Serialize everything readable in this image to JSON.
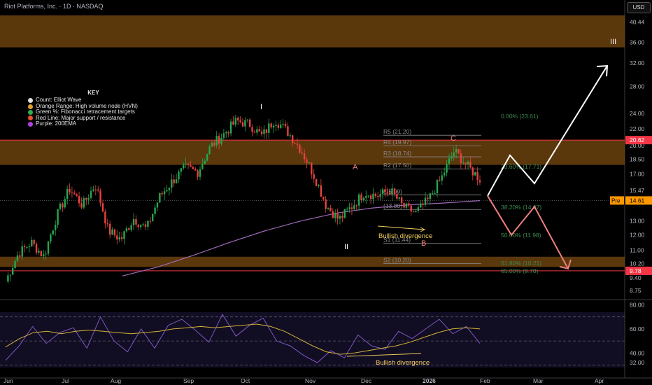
{
  "header": {
    "symbol_line": "Riot Platforms, Inc. · 1D · NASDAQ",
    "currency": "USD"
  },
  "key": {
    "title": "KEY",
    "items": [
      {
        "label": "Count: Elliot Wave",
        "color": "#e0e0e0"
      },
      {
        "label": "Orange Range: High volume node (HVN)",
        "color": "#e0a030"
      },
      {
        "label": "Green %: Fibonacci retracement targets",
        "color": "#2eae4f"
      },
      {
        "label": "Red Line: Major support / resistance",
        "color": "#e8502a"
      },
      {
        "label": "Purple: 200EMA",
        "color": "#b040e0"
      }
    ]
  },
  "price_axis": {
    "ticks": [
      "40.44",
      "36.00",
      "32.00",
      "28.00",
      "24.00",
      "22.00",
      "20.00",
      "18.50",
      "17.00",
      "15.47",
      "13.00",
      "12.00",
      "11.00",
      "10.20",
      "9.40",
      "8.75"
    ],
    "highlight_labels": [
      {
        "text": "20.62",
        "value": 20.62,
        "color": "#f23645"
      },
      {
        "text": "9.78",
        "value": 9.78,
        "color": "#f23645"
      }
    ],
    "pre_label": {
      "tag": "Pre",
      "text": "14.61",
      "value": 14.61,
      "color": "#ff9800"
    }
  },
  "rsi_axis": {
    "ticks": [
      "80.00",
      "60.00",
      "40.00",
      "32.00"
    ]
  },
  "time_axis": {
    "labels": [
      "Jun",
      "Jul",
      "Aug",
      "Sep",
      "Oct",
      "Nov",
      "Dec",
      "2026",
      "Feb",
      "Mar",
      "Apr"
    ]
  },
  "chart_data": {
    "type": "candlestick",
    "title": "Riot Platforms, Inc. · 1D · NASDAQ",
    "y_scale": "log",
    "ylim": [
      8.4,
      42
    ],
    "hvn_zones": [
      [
        35.0,
        42.0
      ],
      [
        17.9,
        20.62
      ],
      [
        10.0,
        10.6
      ]
    ],
    "support_resistance_lines": [
      20.62,
      9.78
    ],
    "pivot_levels": [
      {
        "label": "R5 (21.20)",
        "value": 21.2
      },
      {
        "label": "R4 (19.97)",
        "value": 19.97
      },
      {
        "label": "R3 (18.74)",
        "value": 18.74
      },
      {
        "label": "R2 (17.50)",
        "value": 17.5
      },
      {
        "label": "(15.09)",
        "value": 15.09
      },
      {
        "label": "(13.88)",
        "value": 13.88
      },
      {
        "label": "S1 (11.44)",
        "value": 11.44
      },
      {
        "label": "S2 (10.20)",
        "value": 10.2
      }
    ],
    "fib_levels": [
      {
        "label": "0.00% (23.61)",
        "value": 23.61
      },
      {
        "label": "23.60% (17.71)",
        "value": 17.71
      },
      {
        "label": "38.20% (14.07)",
        "value": 14.07
      },
      {
        "label": "50.00% (11.98)",
        "value": 11.98
      },
      {
        "label": "61.80% (10.21)",
        "value": 10.21
      },
      {
        "label": "65.00% (9.78)",
        "value": 9.78
      }
    ],
    "wave_labels": [
      {
        "text": "I",
        "color": "#ffffff"
      },
      {
        "text": "II",
        "color": "#ffffff"
      },
      {
        "text": "III",
        "color": "#ffffff"
      },
      {
        "text": "A",
        "color": "#f08080"
      },
      {
        "text": "B",
        "color": "#f08080"
      },
      {
        "text": "C",
        "color": "#f08080"
      }
    ],
    "annotations": [
      {
        "text": "Bullish divergence",
        "panel": "price",
        "color": "#f5d060"
      },
      {
        "text": "Bullish divergence",
        "panel": "rsi",
        "color": "#f5d060"
      }
    ],
    "bullish_path": [
      15.0,
      18.9,
      16.1,
      31.5
    ],
    "bearish_path": [
      15.0,
      12.0,
      14.1,
      9.9
    ],
    "last_price": 14.61,
    "candle_anchors": [
      9.2,
      10.8,
      11.5,
      10.6,
      13.4,
      15.6,
      14.2,
      16.0,
      12.3,
      11.7,
      13.2,
      12.4,
      14.9,
      16.3,
      17.6,
      17.2,
      19.9,
      21.3,
      23.0,
      22.6,
      21.1,
      23.2,
      21.6,
      19.6,
      17.0,
      14.2,
      13.1,
      14.1,
      15.3,
      15.0,
      15.5,
      14.1,
      13.6,
      14.7,
      16.6,
      19.4,
      17.8,
      16.5
    ],
    "ema_anchors": [
      9.5,
      10.0,
      10.7,
      11.5,
      12.3,
      13.0,
      13.6,
      14.0,
      14.25,
      14.4,
      14.6
    ],
    "rsi": {
      "ylim": [
        28,
        82
      ],
      "levels": [
        70,
        50,
        30
      ],
      "values": [
        34,
        46,
        62,
        48,
        57,
        61,
        44,
        70,
        50,
        41,
        60,
        44,
        63,
        68,
        59,
        49,
        72,
        54,
        63,
        69,
        50,
        46,
        38,
        32,
        42,
        36,
        55,
        46,
        43,
        58,
        52,
        60,
        68,
        56,
        62,
        48
      ],
      "signal": [
        45,
        52,
        57,
        58,
        56,
        58,
        59,
        58,
        57,
        56,
        57,
        58,
        60,
        61,
        62,
        61,
        62,
        63,
        64,
        62,
        58,
        52,
        46,
        41,
        39,
        40,
        42,
        44,
        46,
        49,
        53,
        57,
        60,
        61,
        60
      ]
    }
  }
}
